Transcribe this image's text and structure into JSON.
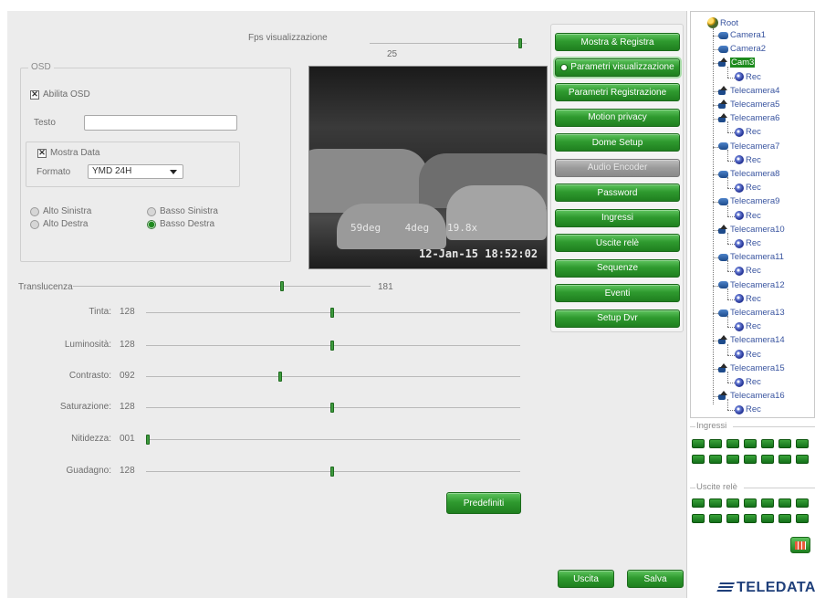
{
  "fps": {
    "label": "Fps visualizzazione",
    "value": "25",
    "level": 0.98
  },
  "osd": {
    "group_title": "OSD",
    "enable_label": "Abilita OSD",
    "enable_checked": true,
    "text_label": "Testo",
    "text_value": "",
    "show_date_label": "Mostra Data",
    "show_date_checked": true,
    "format_label": "Formato",
    "format_value": "YMD 24H",
    "positions": {
      "top_left": "Alto Sinistra",
      "top_right": "Alto Destra",
      "bottom_left": "Basso Sinistra",
      "bottom_right": "Basso Destra"
    },
    "selected_position": "bottom_right"
  },
  "preview": {
    "osd_line1": "59deg    4deg   19.8x",
    "osd_line2": "12-Jan-15 18:52:02"
  },
  "translucency": {
    "label": "Translucenza",
    "value": "181",
    "level": 0.71
  },
  "image_settings": [
    {
      "label": "Tinta:",
      "value": "128",
      "level": 0.5
    },
    {
      "label": "Luminosità:",
      "value": "128",
      "level": 0.5
    },
    {
      "label": "Contrasto:",
      "value": "092",
      "level": 0.36
    },
    {
      "label": "Saturazione:",
      "value": "128",
      "level": 0.5
    },
    {
      "label": "Nitidezza:",
      "value": "001",
      "level": 0.0
    },
    {
      "label": "Guadagno:",
      "value": "128",
      "level": 0.5
    }
  ],
  "buttons": {
    "defaults": "Predefiniti",
    "exit": "Uscita",
    "save": "Salva"
  },
  "menu": [
    {
      "label": "Mostra & Registra",
      "state": "normal"
    },
    {
      "label": "Parametri visualizzazione",
      "state": "active"
    },
    {
      "label": "Parametri Registrazione",
      "state": "normal"
    },
    {
      "label": "Motion privacy",
      "state": "normal"
    },
    {
      "label": "Dome Setup",
      "state": "normal"
    },
    {
      "label": "Audio Encoder",
      "state": "disabled"
    },
    {
      "label": "Password",
      "state": "normal"
    },
    {
      "label": "Ingressi",
      "state": "normal"
    },
    {
      "label": "Uscite relè",
      "state": "normal"
    },
    {
      "label": "Sequenze",
      "state": "normal"
    },
    {
      "label": "Eventi",
      "state": "normal"
    },
    {
      "label": "Setup Dvr",
      "state": "normal"
    }
  ],
  "tree": {
    "root": "Root",
    "nodes": [
      {
        "label": "Camera1",
        "icon": "camera-icon",
        "level": 1,
        "selected": false
      },
      {
        "label": "Camera2",
        "icon": "camera-icon",
        "level": 1,
        "selected": false
      },
      {
        "label": "Cam3",
        "icon": "ptz-camera-icon",
        "level": 1,
        "selected": true
      },
      {
        "label": "Rec",
        "icon": "record-icon",
        "level": 2,
        "selected": false
      },
      {
        "label": "Telecamera4",
        "icon": "ptz-camera-icon",
        "level": 1,
        "selected": false
      },
      {
        "label": "Telecamera5",
        "icon": "ptz-camera-icon",
        "level": 1,
        "selected": false
      },
      {
        "label": "Telecamera6",
        "icon": "ptz-camera-icon",
        "level": 1,
        "selected": false
      },
      {
        "label": "Rec",
        "icon": "record-icon",
        "level": 2,
        "selected": false
      },
      {
        "label": "Telecamera7",
        "icon": "camera-icon",
        "level": 1,
        "selected": false
      },
      {
        "label": "Rec",
        "icon": "record-icon",
        "level": 2,
        "selected": false
      },
      {
        "label": "Telecamera8",
        "icon": "camera-icon",
        "level": 1,
        "selected": false
      },
      {
        "label": "Rec",
        "icon": "record-icon",
        "level": 2,
        "selected": false
      },
      {
        "label": "Telecamera9",
        "icon": "camera-icon",
        "level": 1,
        "selected": false
      },
      {
        "label": "Rec",
        "icon": "record-icon",
        "level": 2,
        "selected": false
      },
      {
        "label": "Telecamera10",
        "icon": "ptz-camera-icon",
        "level": 1,
        "selected": false
      },
      {
        "label": "Rec",
        "icon": "record-icon",
        "level": 2,
        "selected": false
      },
      {
        "label": "Telecamera11",
        "icon": "camera-icon",
        "level": 1,
        "selected": false
      },
      {
        "label": "Rec",
        "icon": "record-icon",
        "level": 2,
        "selected": false
      },
      {
        "label": "Telecamera12",
        "icon": "camera-icon",
        "level": 1,
        "selected": false
      },
      {
        "label": "Rec",
        "icon": "record-icon",
        "level": 2,
        "selected": false
      },
      {
        "label": "Telecamera13",
        "icon": "camera-icon",
        "level": 1,
        "selected": false
      },
      {
        "label": "Rec",
        "icon": "record-icon",
        "level": 2,
        "selected": false
      },
      {
        "label": "Telecamera14",
        "icon": "ptz-camera-icon",
        "level": 1,
        "selected": false
      },
      {
        "label": "Rec",
        "icon": "record-icon",
        "level": 2,
        "selected": false
      },
      {
        "label": "Telecamera15",
        "icon": "ptz-camera-icon",
        "level": 1,
        "selected": false
      },
      {
        "label": "Rec",
        "icon": "record-icon",
        "level": 2,
        "selected": false
      },
      {
        "label": "Telecamera16",
        "icon": "ptz-camera-icon",
        "level": 1,
        "selected": false
      },
      {
        "label": "Rec",
        "icon": "record-icon",
        "level": 2,
        "selected": false
      }
    ]
  },
  "inputs_section": {
    "label": "Ingressi"
  },
  "relays_section": {
    "label": "Uscite relè"
  },
  "logo": {
    "text": "TELEDATA"
  },
  "colors": {
    "accent_green": "#2f9a2f",
    "tree_text": "#3a55a0",
    "logo_blue": "#1f3f7a"
  }
}
